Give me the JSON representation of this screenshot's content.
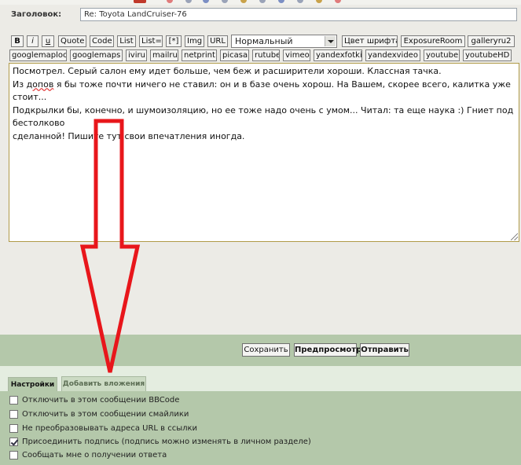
{
  "subject": {
    "label": "Заголовок:",
    "value": "Re: Toyota LandCruiser-76"
  },
  "toolbar": {
    "row1": [
      "B",
      "i",
      "u",
      "Quote",
      "Code",
      "List",
      "List=",
      "[*]",
      "Img",
      "URL"
    ],
    "font_size_select": "Нормальный",
    "row1_right": [
      "Цвет шрифта",
      "ExposureRoom",
      "galleryru2"
    ],
    "row2": [
      "googlemaploc",
      "googlemaps",
      "iviru",
      "mailru",
      "netprint",
      "picasa",
      "rutube",
      "vimeo",
      "yandexfotki",
      "yandexvideo",
      "youtube",
      "youtubeHD"
    ]
  },
  "editor": {
    "lines": [
      "Посмотрел. Серый салон ему идет больше, чем беж и расширители хороши. Классная тачка.",
      "Из допов я бы тоже почти ничего не ставил: он и в базе очень хорош. На Вашем, скорее всего, калитка уже стоит...",
      "Подкрылки бы, конечно, и шумоизоляцию, но ее тоже надо очень с умом... Читал: та еще наука :) Гниет под бестолково",
      "сделанной! Пишите тут свои впечатления иногда."
    ],
    "misspelled_word": "допов"
  },
  "actions": {
    "save": "Сохранить",
    "preview": "Предпросмотр",
    "submit": "Отправить"
  },
  "tabs": {
    "settings": "Настройки",
    "attachments": "Добавить вложения"
  },
  "options": [
    {
      "label": "Отключить в этом сообщении BBCode",
      "checked": false
    },
    {
      "label": "Отключить в этом сообщении смайлики",
      "checked": false
    },
    {
      "label": "Не преобразовывать адреса URL в ссылки",
      "checked": false
    },
    {
      "label": "Присоединить подпись (подпись можно изменять в личном разделе)",
      "checked": true
    },
    {
      "label": "Сообщать мне о получении ответа",
      "checked": false
    }
  ],
  "colors": {
    "accent_green": "#b4c8aa",
    "annotation_arrow": "#e8161b",
    "panel_bg": "#ecebe6",
    "editor_border": "#b09a48"
  }
}
